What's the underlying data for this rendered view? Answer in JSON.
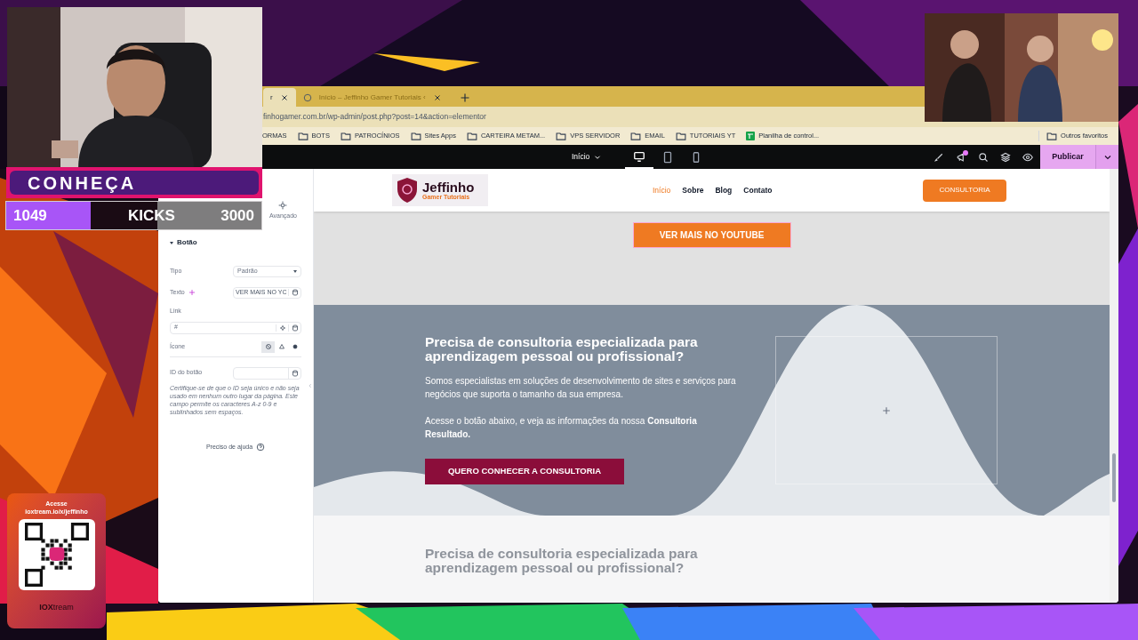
{
  "stream_overlay": {
    "banner": "CONHEÇA",
    "goal_bar": {
      "current": "1049",
      "label": "KICKS",
      "goal": "3000",
      "level": 0.33
    },
    "qr_card": {
      "title": "Acesse",
      "url": "ioxtream.io/x/jeffinho",
      "brand": "**IOX**tream"
    }
  },
  "browser": {
    "tabs": [
      {
        "label": "r",
        "selected": true
      },
      {
        "label": "Início – Jeffinho Gamer Tutoriais ‹",
        "selected": false
      }
    ],
    "url": "finhogamer.com.br/wp-admin/post.php?post=14&action=elementor",
    "bookmarks": [
      {
        "label": "ORMAS",
        "kind": "partial"
      },
      {
        "label": "BOTS",
        "kind": "folder"
      },
      {
        "label": "PATROCÍNIOS",
        "kind": "folder"
      },
      {
        "label": "Sites Apps",
        "kind": "folder"
      },
      {
        "label": "CARTEIRA METAM...",
        "kind": "folder"
      },
      {
        "label": "VPS SERVIDOR",
        "kind": "folder"
      },
      {
        "label": "EMAIL",
        "kind": "folder"
      },
      {
        "label": "TUTORIAIS YT",
        "kind": "folder"
      },
      {
        "label": "Planilha de control...",
        "kind": "sheet"
      }
    ],
    "other_bookmarks": "Outros favoritos"
  },
  "editor_bar": {
    "page": "Início",
    "devices": [
      {
        "kind": "desktop",
        "selected": true
      },
      {
        "kind": "tablet",
        "selected": false
      },
      {
        "kind": "mobile",
        "selected": false
      }
    ],
    "publish": "Publicar"
  },
  "panel": {
    "tab": "Avançado",
    "section": {
      "title": "Botão",
      "expanded": true
    },
    "fields": [
      {
        "kind": "select",
        "label": "Tipo",
        "value": "Padrão"
      },
      {
        "kind": "text",
        "label": "Texto",
        "value": "VER MAIS NO YC"
      },
      {
        "kind": "link",
        "label": "Link",
        "value": "#"
      },
      {
        "kind": "choice",
        "label": "Ícone",
        "options": [
          {
            "selected": true
          },
          {
            "selected": false
          },
          {
            "selected": false
          }
        ]
      },
      {
        "kind": "id",
        "label": "ID do botão"
      }
    ],
    "help_text": "Certifique-se de que o ID seja único e não seja usado em nenhum outro lugar da página. Este campo permite os caracteres A-z  0-9 e sublinhados sem espaços.",
    "help_link": "Preciso de ajuda"
  },
  "site": {
    "logo": {
      "title": "Jeffinho",
      "subtitle": "Gamer Tutoriais"
    },
    "nav": [
      {
        "label": "Início",
        "selected": true
      },
      {
        "label": "Sobre",
        "selected": false
      },
      {
        "label": "Blog",
        "selected": false
      },
      {
        "label": "Contato",
        "selected": false
      }
    ],
    "cta": "CONSULTORIA",
    "youtube_button": "VER MAIS NO YOUTUBE",
    "section": {
      "heading": "Precisa de consultoria especializada para aprendizagem pessoal ou profissional?",
      "paragraph": "Somos especialistas em soluções de desenvolvimento de sites e serviços para negócios que suporta o tamanho da sua empresa.",
      "paragraph_2": "Acesse o botão abaixo, e veja as informações da nossa **Consultoria Resultado.**",
      "button": "QUERO CONHECER A CONSULTORIA"
    },
    "faded_heading": "Precisa de consultoria especializada para aprendizagem pessoal ou profissional?"
  }
}
